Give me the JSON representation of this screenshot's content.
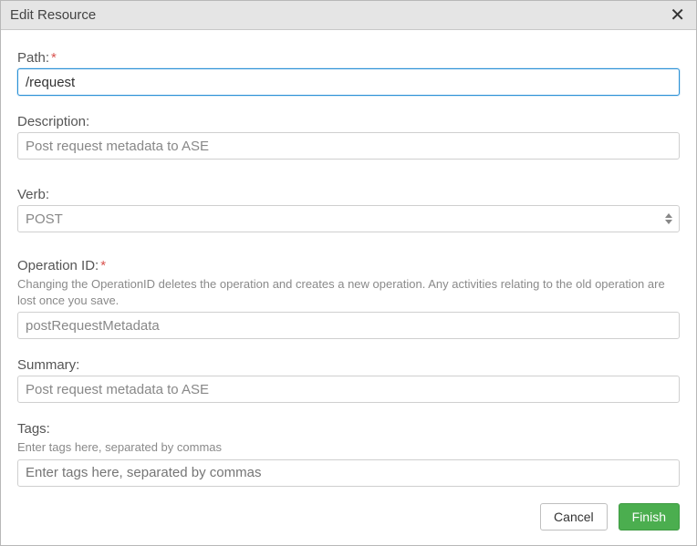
{
  "dialog": {
    "title": "Edit Resource",
    "close_glyph": "✕"
  },
  "fields": {
    "path": {
      "label": "Path:",
      "required_mark": "*",
      "value": "/request"
    },
    "description": {
      "label": "Description:",
      "value": "Post request metadata to ASE"
    },
    "verb": {
      "label": "Verb:",
      "selected": "POST"
    },
    "operation_id": {
      "label": "Operation ID:",
      "required_mark": "*",
      "help": "Changing the OperationID deletes the operation and creates a new operation. Any activities relating to the old operation are lost once you save.",
      "value": "postRequestMetadata"
    },
    "summary": {
      "label": "Summary:",
      "value": "Post request metadata to ASE"
    },
    "tags": {
      "label": "Tags:",
      "help": "Enter tags here, separated by commas",
      "placeholder": "Enter tags here, separated by commas"
    }
  },
  "buttons": {
    "cancel": "Cancel",
    "finish": "Finish"
  }
}
